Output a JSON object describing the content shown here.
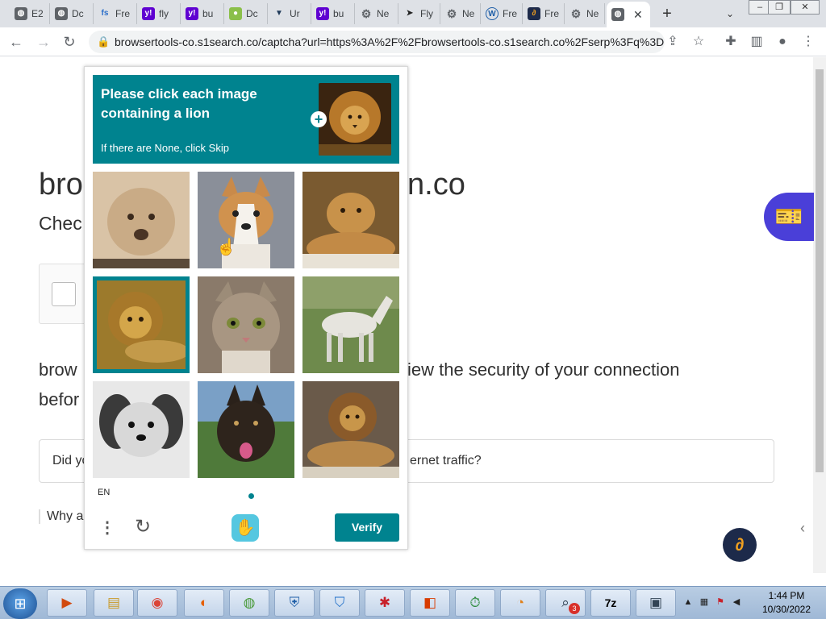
{
  "browser": {
    "tabs": [
      {
        "title": "E2",
        "icon": "globe-icon"
      },
      {
        "title": "Dc",
        "icon": "globe-icon"
      },
      {
        "title": "Fre",
        "icon": "fs-icon"
      },
      {
        "title": "fly",
        "icon": "yahoo-icon"
      },
      {
        "title": "bu",
        "icon": "yahoo-icon"
      },
      {
        "title": "Dc",
        "icon": "frog-icon"
      },
      {
        "title": "Ur",
        "icon": "vee-icon"
      },
      {
        "title": "bu",
        "icon": "yahoo-icon"
      },
      {
        "title": "Ne",
        "icon": "gear-icon"
      },
      {
        "title": "Fly",
        "icon": "cursor-icon"
      },
      {
        "title": "Ne",
        "icon": "gear-icon"
      },
      {
        "title": "Fre",
        "icon": "wp-icon"
      },
      {
        "title": "Fre",
        "icon": "link-icon"
      },
      {
        "title": "Ne",
        "icon": "gear-icon"
      }
    ],
    "active_tab_icon": "globe-icon",
    "address": "browsertools-co.s1search.co/captcha?url=https%3A%2F%2Fbrowsertools-co.s1search.co%2Fserp%3Fq%3D..."
  },
  "page": {
    "title_left": "bro",
    "title_right": "n.co",
    "subtitle": "Chec",
    "para1_left": "brow",
    "para1_right": "iew the security of your connection",
    "para2": "befor",
    "callout_left": "Did yo",
    "callout_right": "ernet traffic?",
    "why": "Why a"
  },
  "captcha": {
    "prompt": "Please click each image containing a lion",
    "hint": "If there are None, click Skip",
    "language": "EN",
    "verify_label": "Verify",
    "tiles": [
      {
        "subject": "poodle",
        "selected": false
      },
      {
        "subject": "corgi",
        "selected": false
      },
      {
        "subject": "lioness",
        "selected": false
      },
      {
        "subject": "lion",
        "selected": true
      },
      {
        "subject": "tabby-cat",
        "selected": false
      },
      {
        "subject": "white-horse",
        "selected": false
      },
      {
        "subject": "shaggy-dog",
        "selected": false
      },
      {
        "subject": "black-dog",
        "selected": false
      },
      {
        "subject": "lion",
        "selected": false
      }
    ]
  },
  "taskbar": {
    "time": "1:44 PM",
    "date": "10/30/2022",
    "apps": [
      "media-player-icon",
      "file-explorer-icon",
      "chrome-icon",
      "firefox-icon",
      "globe-app-icon",
      "shield-app-icon",
      "vpn-shield-icon",
      "settings-app-icon",
      "office-icon",
      "timer-icon",
      "speed-icon",
      "search-app-icon",
      "7zip-icon",
      "network-app-icon"
    ],
    "badge": "3",
    "sevenzip": "7z"
  }
}
